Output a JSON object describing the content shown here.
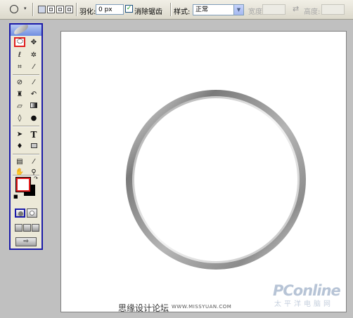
{
  "options_bar": {
    "feather_label": "羽化:",
    "feather_value": "0 px",
    "antialias_label": "消除锯齿",
    "antialias_checked": true,
    "style_label": "样式:",
    "style_value": "正常",
    "width_label": "宽度:",
    "height_label": "高度:"
  },
  "colors": {
    "foreground": "#ffffff",
    "background": "#000000",
    "panel_border": "#1a1aa8",
    "selection_highlight": "#e01e1e"
  },
  "tools": {
    "selected": "elliptical-marquee-tool",
    "type_tool_label": "T"
  },
  "watermarks": {
    "site_cn": "思缘设计论坛",
    "site_url": "WWW.MISSYUAN.COM",
    "brand": "PConline",
    "brand_cn": "太平洋电脑网"
  }
}
